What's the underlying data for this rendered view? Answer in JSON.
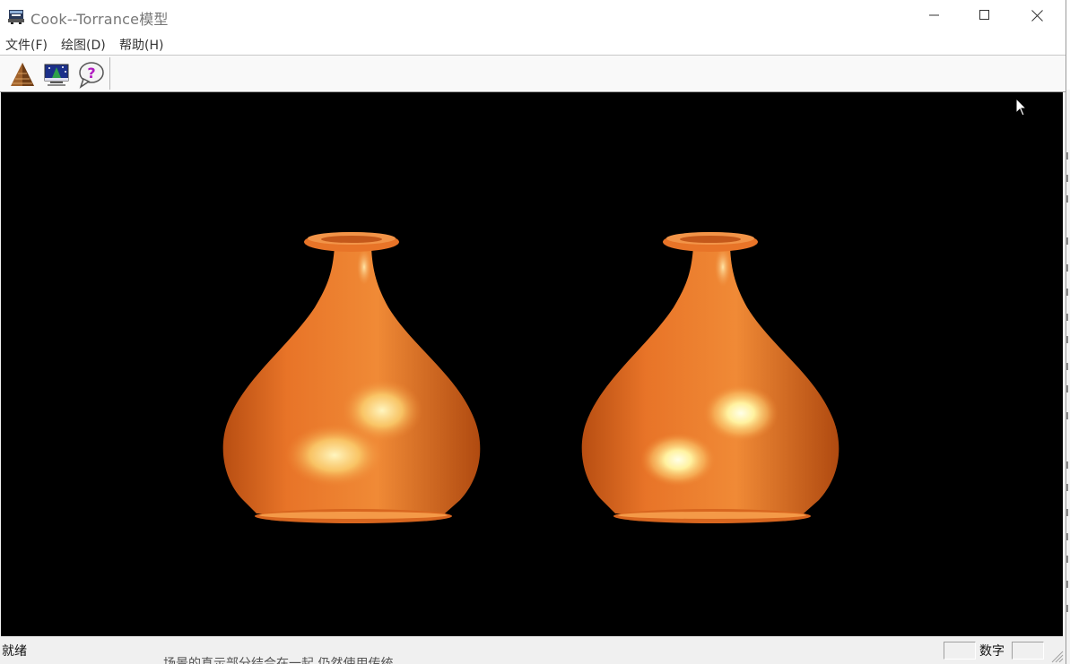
{
  "window": {
    "title": "Cook--Torrance模型"
  },
  "menu": {
    "items": [
      {
        "label": "文件(F)"
      },
      {
        "label": "绘图(D)"
      },
      {
        "label": "帮助(H)"
      }
    ]
  },
  "toolbar": {
    "buttons": [
      {
        "icon": "pyramid-icon"
      },
      {
        "icon": "scene-picture-icon"
      },
      {
        "icon": "help-bubble-icon"
      }
    ]
  },
  "scene": {
    "object_color": "#e8762a",
    "background": "#000000"
  },
  "statusbar": {
    "status_text": "就绪",
    "num_label": "数字"
  },
  "background_window": {
    "partial_text": "场景的真示部分结合在一起,仍然使用传统..."
  }
}
